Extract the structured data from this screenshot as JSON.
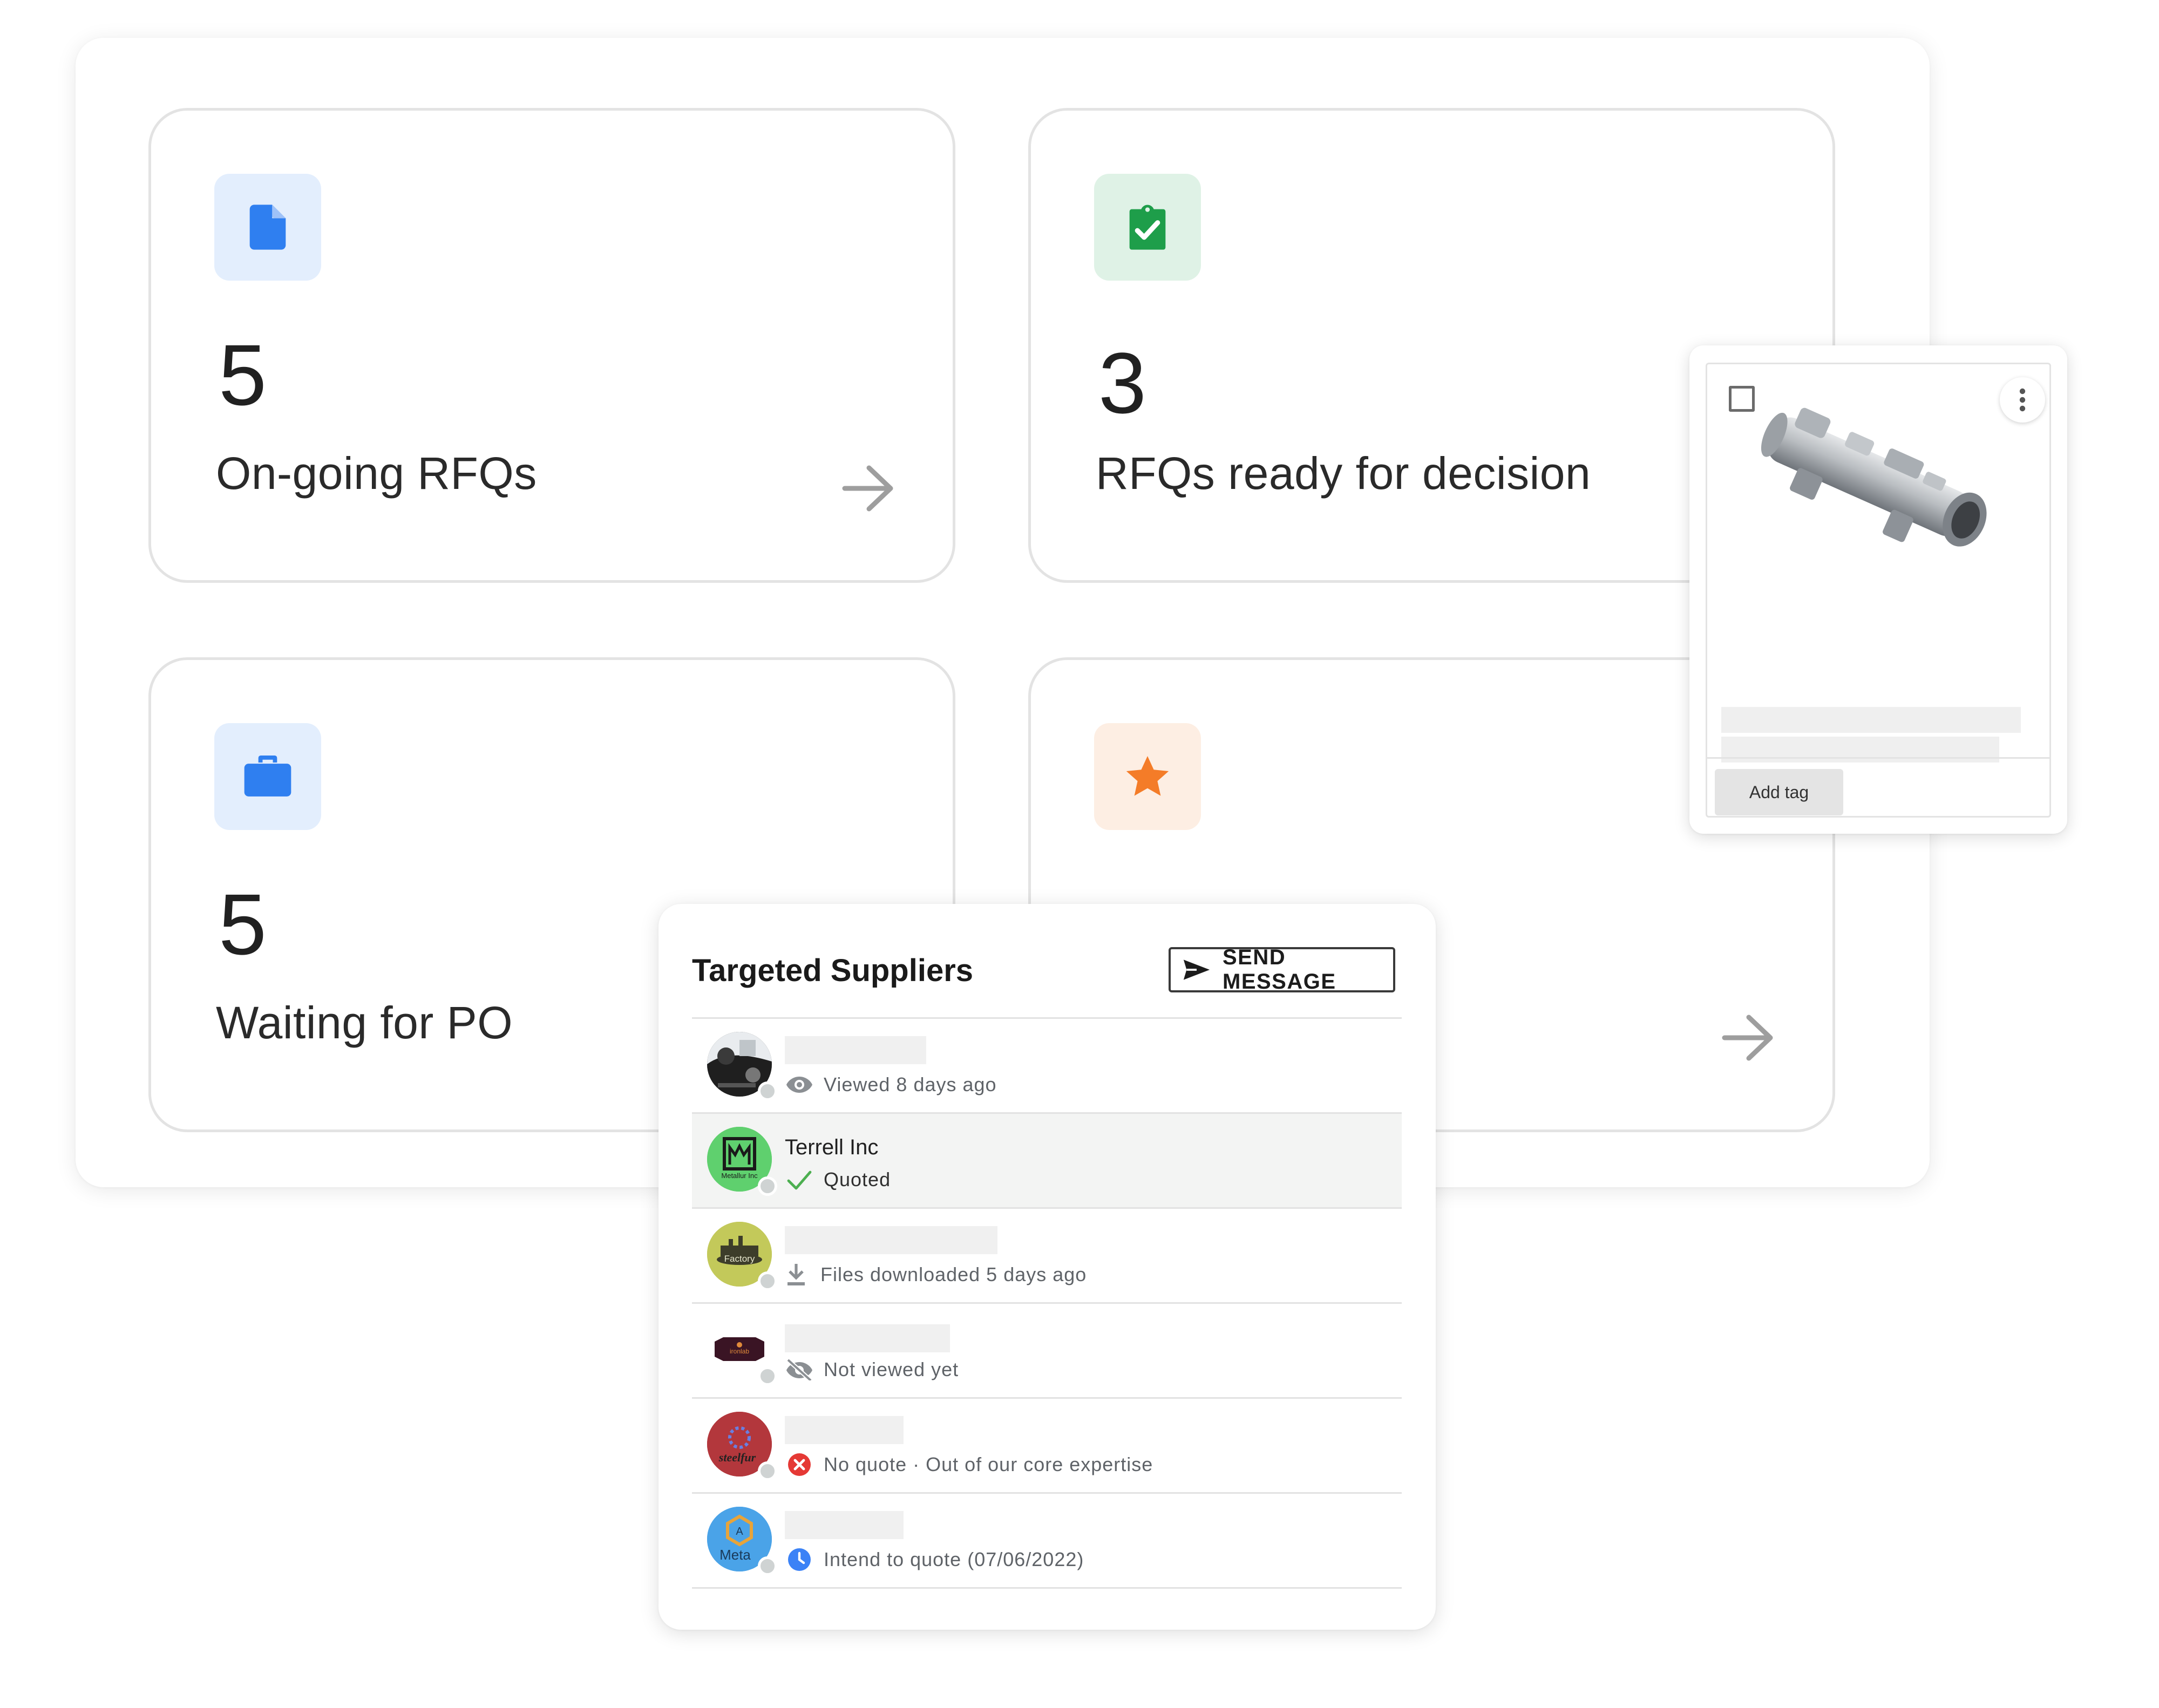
{
  "stats": [
    {
      "count": "5",
      "label": "On-going RFQs",
      "icon": "document-icon",
      "icon_color": "#2f7ff0",
      "icon_bg": "#e3eefd"
    },
    {
      "count": "3",
      "label": "RFQs ready for decision",
      "icon": "clipboard-check-icon",
      "icon_color": "#1e9e4a",
      "icon_bg": "#dff2e6"
    },
    {
      "count": "5",
      "label": "Waiting for PO",
      "icon": "briefcase-icon",
      "icon_color": "#2f7ff0",
      "icon_bg": "#e3eefd"
    },
    {
      "count": "",
      "label": "",
      "icon": "star-icon",
      "icon_color": "#f47c28",
      "icon_bg": "#fdeee3"
    }
  ],
  "suppliers_panel": {
    "title": "Targeted Suppliers",
    "send_message_label": "SEND MESSAGE",
    "suppliers": [
      {
        "name": "",
        "status": "Viewed 8 days ago",
        "status_icon": "eye-icon"
      },
      {
        "name": "Terrell Inc",
        "status": "Quoted",
        "status_icon": "check-icon"
      },
      {
        "name": "",
        "status": "Files downloaded 5 days ago",
        "status_icon": "download-icon"
      },
      {
        "name": "",
        "status": "Not viewed yet",
        "status_icon": "eye-off-icon"
      },
      {
        "name": "",
        "status": "No quote · Out of our core expertise",
        "status_icon": "x-circle-icon"
      },
      {
        "name": "",
        "status": "Intend to quote (07/06/2022)",
        "status_icon": "clock-icon"
      }
    ],
    "avatar_texts": [
      "",
      "Metallur Inc",
      "Factory",
      "ironlab",
      "steelfur",
      "Meta"
    ]
  },
  "product_card": {
    "add_tag_label": "Add tag"
  },
  "colors": {
    "accent_blue": "#2f7ff0",
    "accent_green": "#1e9e4a",
    "accent_orange": "#f47c28",
    "error_red": "#e53935",
    "status_grey": "#5f6368"
  }
}
